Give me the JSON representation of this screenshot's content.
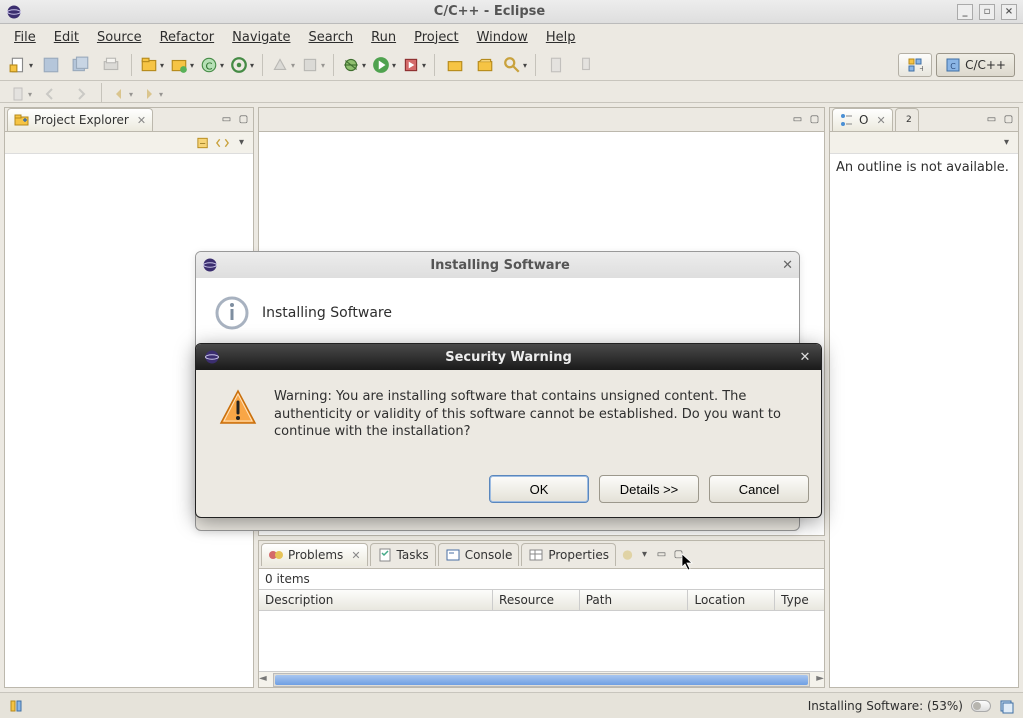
{
  "window": {
    "title": "C/C++ - Eclipse"
  },
  "menu": {
    "file": "File",
    "edit": "Edit",
    "source": "Source",
    "refactor": "Refactor",
    "navigate": "Navigate",
    "search": "Search",
    "run": "Run",
    "project": "Project",
    "window": "Window",
    "help": "Help"
  },
  "perspective": {
    "label": "C/C++"
  },
  "views": {
    "project_explorer": {
      "title": "Project Explorer"
    },
    "outline": {
      "title_short": "O",
      "message": "An outline is not available."
    },
    "bottom": {
      "problems": "Problems",
      "tasks": "Tasks",
      "console": "Console",
      "properties": "Properties",
      "items_label": "0 items",
      "columns": {
        "description": "Description",
        "resource": "Resource",
        "path": "Path",
        "location": "Location",
        "type": "Type"
      }
    }
  },
  "install_dialog": {
    "title": "Installing Software",
    "header": "Installing Software"
  },
  "security_dialog": {
    "title": "Security Warning",
    "message": "Warning: You are installing software that contains unsigned content. The authenticity or validity of this software cannot be established. Do you want to continue with the installation?",
    "ok": "OK",
    "details": "Details >>",
    "cancel": "Cancel"
  },
  "status": {
    "progress_text": "Installing Software: (53%)"
  }
}
